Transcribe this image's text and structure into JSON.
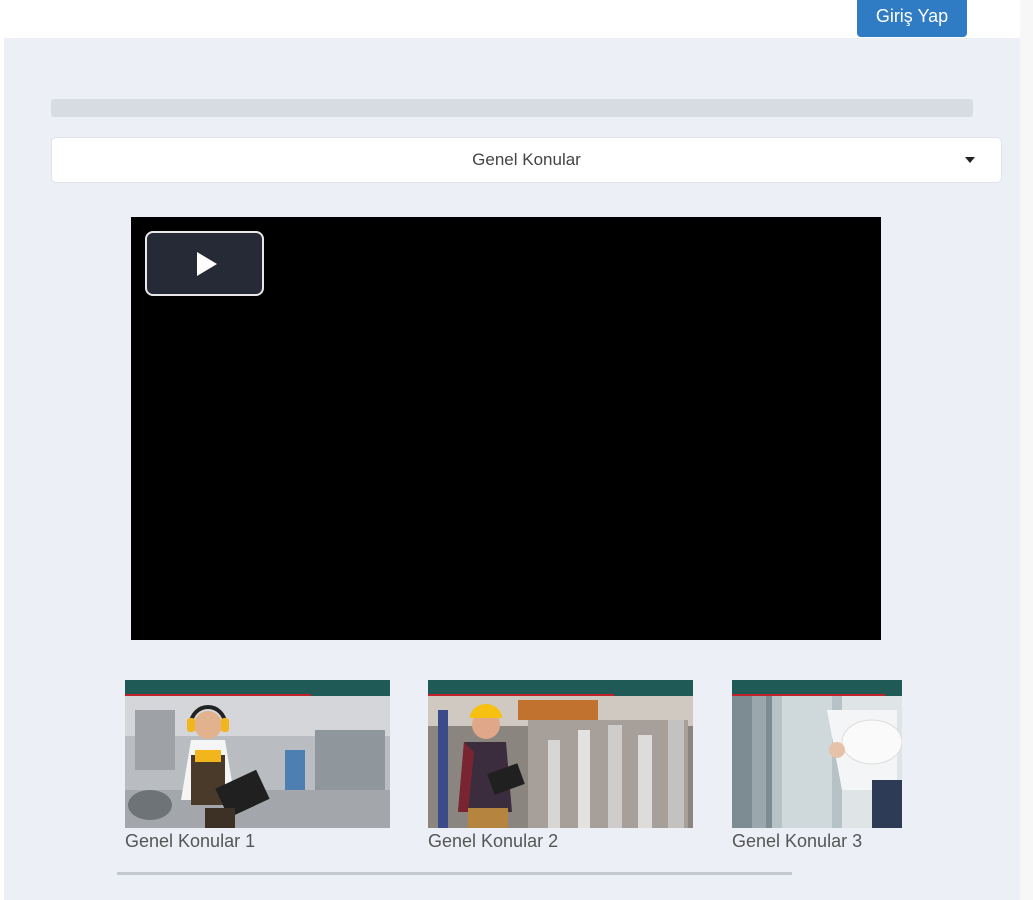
{
  "header": {
    "login_label": "Giriş Yap"
  },
  "category_select": {
    "selected": "Genel Konular"
  },
  "video_player": {
    "play_icon": "play-icon"
  },
  "thumbnails": [
    {
      "label": "Genel Konular 1"
    },
    {
      "label": "Genel Konular 2"
    },
    {
      "label": "Genel Konular 3"
    }
  ],
  "colors": {
    "accent": "#2f7bc4",
    "background": "#eceff5",
    "thumb_strip": "#1f5a56"
  }
}
